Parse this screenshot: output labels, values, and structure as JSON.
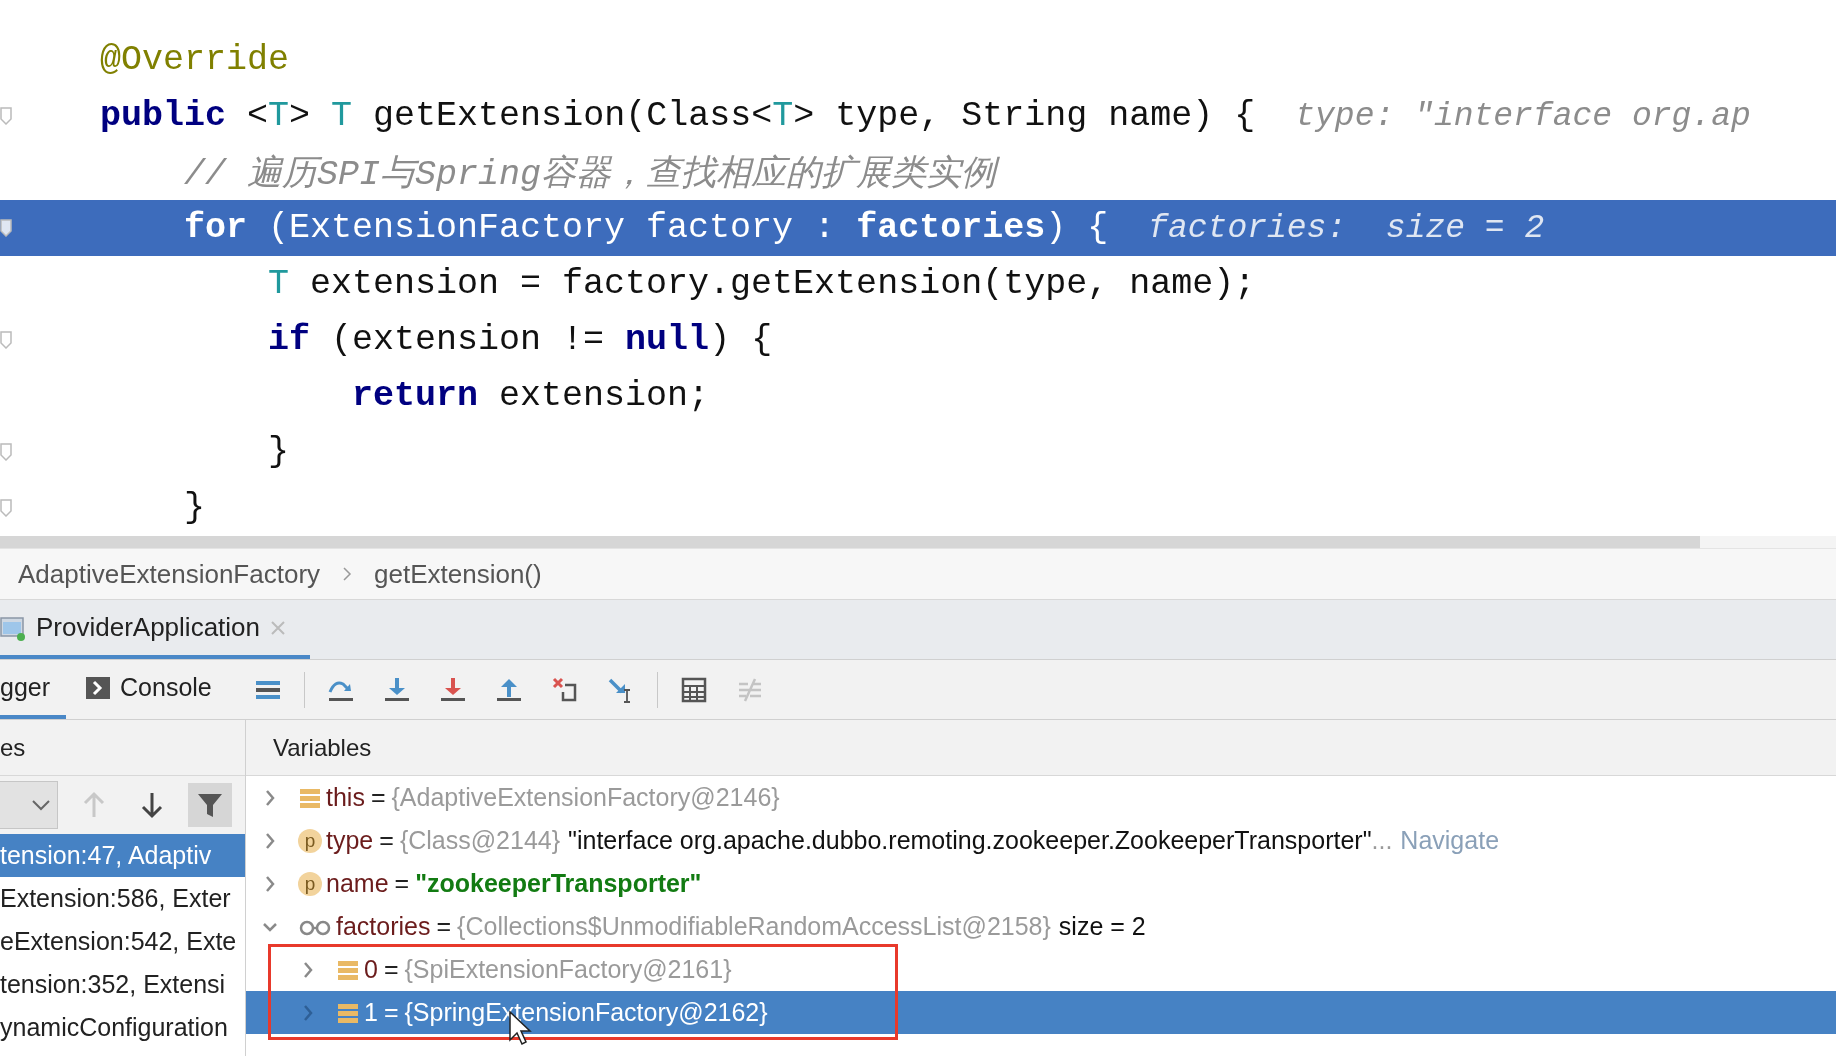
{
  "editor": {
    "lines": [
      {
        "tokens": [
          {
            "text": "@Override",
            "kind": "annotation"
          }
        ],
        "current": false,
        "fold_marker": false
      },
      {
        "tokens": [
          {
            "text": "public",
            "kind": "keyword"
          },
          {
            "text": " <",
            "kind": "plain"
          },
          {
            "text": "T",
            "kind": "typeparam"
          },
          {
            "text": "> ",
            "kind": "plain"
          },
          {
            "text": "T",
            "kind": "typeparam"
          },
          {
            "text": " getExtension(Class<",
            "kind": "plain"
          },
          {
            "text": "T",
            "kind": "typeparam"
          },
          {
            "text": "> type, String name) {",
            "kind": "plain"
          }
        ],
        "hint": "type: \"interface org.ap",
        "current": false,
        "fold_marker": true
      },
      {
        "tokens": [
          {
            "text": "    // 遍历SPI与Spring容器，查找相应的扩展类实例",
            "kind": "comment"
          }
        ],
        "current": false,
        "fold_marker": false
      },
      {
        "tokens": [
          {
            "text": "    for",
            "kind": "keyword"
          },
          {
            "text": " (ExtensionFactory factory : ",
            "kind": "plain"
          },
          {
            "text": "factories",
            "kind": "field"
          },
          {
            "text": ") {",
            "kind": "plain"
          }
        ],
        "hint": "factories:  size = 2",
        "current": true,
        "fold_marker": true
      },
      {
        "tokens": [
          {
            "text": "        T",
            "kind": "typeparam"
          },
          {
            "text": " extension = factory.getExtension(type, name);",
            "kind": "plain"
          }
        ],
        "current": false,
        "fold_marker": false
      },
      {
        "tokens": [
          {
            "text": "        if",
            "kind": "keyword"
          },
          {
            "text": " (extension != ",
            "kind": "plain"
          },
          {
            "text": "null",
            "kind": "keyword"
          },
          {
            "text": ") {",
            "kind": "plain"
          }
        ],
        "current": false,
        "fold_marker": true
      },
      {
        "tokens": [
          {
            "text": "            return",
            "kind": "keyword"
          },
          {
            "text": " extension;",
            "kind": "plain"
          }
        ],
        "current": false,
        "fold_marker": false
      },
      {
        "tokens": [
          {
            "text": "        }",
            "kind": "plain"
          }
        ],
        "current": false,
        "fold_marker": true
      },
      {
        "tokens": [
          {
            "text": "    }",
            "kind": "plain"
          }
        ],
        "current": false,
        "fold_marker": true
      }
    ]
  },
  "breadcrumbs": [
    "AdaptiveExtensionFactory",
    "getExtension()"
  ],
  "run_tabs": [
    {
      "label": "ProviderApplication",
      "selected": true
    }
  ],
  "debug_tabs": [
    {
      "label": "gger",
      "selected": true,
      "kind": "debugger"
    },
    {
      "label": "Console",
      "selected": false,
      "kind": "console"
    }
  ],
  "debug_toolbar": [
    {
      "kind": "layout",
      "disabled": false
    },
    {
      "kind": "step_over",
      "disabled": false
    },
    {
      "kind": "step_into",
      "disabled": false
    },
    {
      "kind": "force_step_into",
      "disabled": false
    },
    {
      "kind": "step_out",
      "disabled": false
    },
    {
      "kind": "drop_frame",
      "disabled": false
    },
    {
      "kind": "run_to_cursor",
      "disabled": false
    },
    {
      "kind": "evaluate",
      "disabled": false
    },
    {
      "kind": "trace",
      "disabled": true
    }
  ],
  "frames": {
    "header": "es",
    "toolbar": [
      {
        "kind": "up",
        "disabled": true
      },
      {
        "kind": "down",
        "disabled": false
      },
      {
        "kind": "filter",
        "on": true
      }
    ],
    "items": [
      {
        "label": "tension:47, Adaptiv",
        "selected": true
      },
      {
        "label": "Extension:586, Exter",
        "selected": false
      },
      {
        "label": "eExtension:542, Exte",
        "selected": false
      },
      {
        "label": "tension:352, Extensi",
        "selected": false
      },
      {
        "label": "ynamicConfiguration",
        "selected": false
      }
    ]
  },
  "variables": {
    "header": "Variables",
    "items": [
      {
        "kind": "field",
        "name": "this",
        "equals": "=",
        "value": "{AdaptiveExtensionFactory@2146}",
        "expanded": false,
        "selected": false
      },
      {
        "kind": "param",
        "badge": "p",
        "name": "type",
        "equals": "=",
        "value": "{Class@2144}",
        "detail": "\"interface org.apache.dubbo.remoting.zookeeper.ZookeeperTransporter\"",
        "ellipsis": "...",
        "link": "Navigate",
        "expanded": false,
        "selected": false
      },
      {
        "kind": "param",
        "badge": "p",
        "name": "name",
        "equals": "=",
        "string_value": "\"zookeeperTransporter\"",
        "expanded": false,
        "selected": false
      },
      {
        "kind": "watch",
        "name": "factories",
        "equals": "=",
        "value": "{Collections$UnmodifiableRandomAccessList@2158}",
        "detail": "size = 2",
        "expanded": true,
        "selected": false,
        "children": [
          {
            "kind": "field",
            "name": "0",
            "equals": "=",
            "value": "{SpiExtensionFactory@2161}",
            "expanded": false,
            "selected": false
          },
          {
            "kind": "field",
            "name": "1",
            "equals": "=",
            "value": "{SpringExtensionFactory@2162}",
            "expanded": false,
            "selected": true
          }
        ]
      }
    ]
  }
}
